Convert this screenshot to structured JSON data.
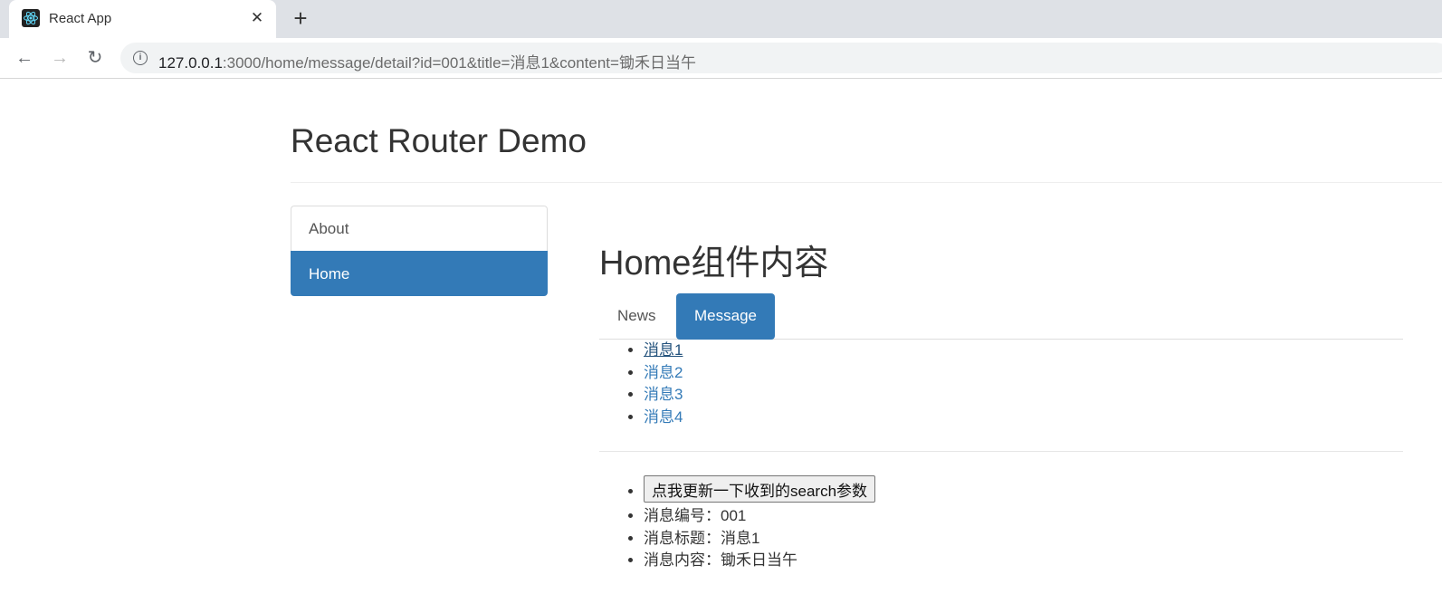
{
  "browser": {
    "tab_title": "React App",
    "close_glyph": "✕",
    "new_tab_glyph": "+",
    "back_glyph": "←",
    "forward_glyph": "→",
    "reload_glyph": "↻",
    "info_glyph": "i",
    "url_host": "127.0.0.1",
    "url_path": ":3000/home/message/detail?id=001&title=消息1&content=锄禾日当午"
  },
  "header": {
    "title": "React Router Demo"
  },
  "sidebar": {
    "items": [
      {
        "label": "About",
        "active": false
      },
      {
        "label": "Home",
        "active": true
      }
    ]
  },
  "main": {
    "title": "Home组件内容",
    "tabs": [
      {
        "label": "News",
        "active": false
      },
      {
        "label": "Message",
        "active": true
      }
    ],
    "messages": [
      "消息1",
      "消息2",
      "消息3",
      "消息4"
    ],
    "detail": {
      "button_label": "点我更新一下收到的search参数",
      "id_line": "消息编号：001",
      "title_line": "消息标题：消息1",
      "content_line": "消息内容：锄禾日当午"
    }
  },
  "colors": {
    "accent": "#337ab7",
    "link": "#337ab7",
    "tabstrip": "#dee1e6"
  },
  "icons": [
    "react-logo-icon",
    "close-icon",
    "plus-icon",
    "back-arrow-icon",
    "forward-arrow-icon",
    "reload-icon",
    "info-icon"
  ]
}
